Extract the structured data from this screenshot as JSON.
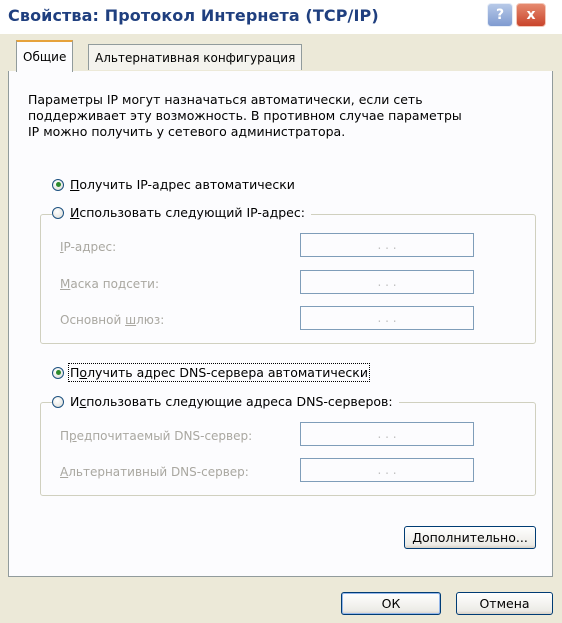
{
  "window": {
    "title": "Свойства: Протокол Интернета (TCP/IP)",
    "help_label": "?",
    "close_label": "x"
  },
  "tabs": [
    {
      "label": "Общие",
      "active": true
    },
    {
      "label": "Альтернативная конфигурация",
      "active": false
    }
  ],
  "general": {
    "description_lines": [
      "Параметры IP могут назначаться автоматически, если сеть",
      "поддерживает эту возможность. В противном случае параметры",
      "IP можно получить у сетевого администратора."
    ],
    "ip_auto": {
      "mnemonic": "П",
      "rest": "олучить IP-адрес автоматически",
      "checked": true
    },
    "ip_manual": {
      "mnemonic": "И",
      "rest": "спользовать следующий IP-адрес:",
      "checked": false
    },
    "ip_fields": [
      {
        "mnemonic": "I",
        "rest": "P-адрес:",
        "value": ". . ."
      },
      {
        "mnemonic": "М",
        "rest": "аска подсети:",
        "value": ". . ."
      },
      {
        "pre": "Основной ",
        "mnemonic": "ш",
        "rest": "люз:",
        "value": ". . ."
      }
    ],
    "dns_auto": {
      "pre": "П",
      "mnemonic": "о",
      "rest": "лучить адрес DNS-сервера автоматически",
      "checked": true
    },
    "dns_manual": {
      "pre": "И",
      "mnemonic": "с",
      "rest": "пользовать следующие адреса DNS-серверов:",
      "checked": false
    },
    "dns_fields": [
      {
        "pre": "П",
        "mnemonic": "р",
        "rest": "едпочитаемый DNS-сервер:",
        "value": ". . ."
      },
      {
        "mnemonic": "А",
        "rest": "льтернативный DNS-сервер:",
        "value": ". . ."
      }
    ],
    "advanced": {
      "mnemonic": "Д",
      "rest": "ополнительно..."
    }
  },
  "buttons": {
    "ok": "ОК",
    "cancel": "Отмена"
  }
}
